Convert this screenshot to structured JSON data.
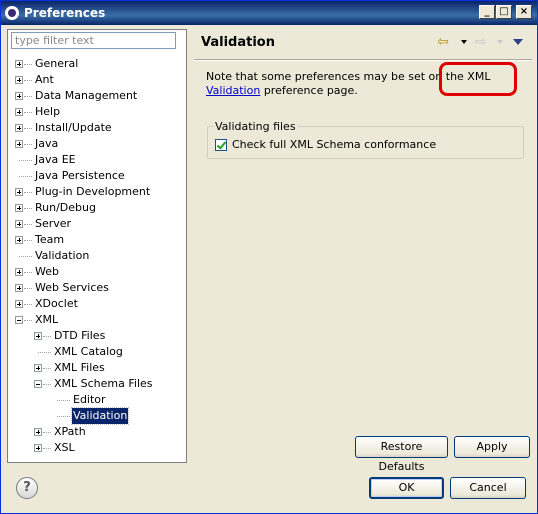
{
  "window": {
    "title": "Preferences",
    "controls": {
      "minimize": "_",
      "maximize": "□",
      "close": "×"
    }
  },
  "filter": {
    "placeholder": "type filter text",
    "value": ""
  },
  "tree": [
    {
      "label": "General",
      "level": 0,
      "expander": "plus"
    },
    {
      "label": "Ant",
      "level": 0,
      "expander": "plus"
    },
    {
      "label": "Data Management",
      "level": 0,
      "expander": "plus"
    },
    {
      "label": "Help",
      "level": 0,
      "expander": "plus"
    },
    {
      "label": "Install/Update",
      "level": 0,
      "expander": "plus"
    },
    {
      "label": "Java",
      "level": 0,
      "expander": "plus"
    },
    {
      "label": "Java EE",
      "level": 0,
      "expander": "none"
    },
    {
      "label": "Java Persistence",
      "level": 0,
      "expander": "none"
    },
    {
      "label": "Plug-in Development",
      "level": 0,
      "expander": "plus"
    },
    {
      "label": "Run/Debug",
      "level": 0,
      "expander": "plus"
    },
    {
      "label": "Server",
      "level": 0,
      "expander": "plus"
    },
    {
      "label": "Team",
      "level": 0,
      "expander": "plus"
    },
    {
      "label": "Validation",
      "level": 0,
      "expander": "none"
    },
    {
      "label": "Web",
      "level": 0,
      "expander": "plus"
    },
    {
      "label": "Web Services",
      "level": 0,
      "expander": "plus"
    },
    {
      "label": "XDoclet",
      "level": 0,
      "expander": "plus"
    },
    {
      "label": "XML",
      "level": 0,
      "expander": "minus"
    },
    {
      "label": "DTD Files",
      "level": 1,
      "expander": "plus"
    },
    {
      "label": "XML Catalog",
      "level": 1,
      "expander": "none"
    },
    {
      "label": "XML Files",
      "level": 1,
      "expander": "plus"
    },
    {
      "label": "XML Schema Files",
      "level": 1,
      "expander": "minus"
    },
    {
      "label": "Editor",
      "level": 2,
      "expander": "none"
    },
    {
      "label": "Validation",
      "level": 2,
      "expander": "none",
      "selected": true
    },
    {
      "label": "XPath",
      "level": 1,
      "expander": "plus"
    },
    {
      "label": "XSL",
      "level": 1,
      "expander": "plus"
    }
  ],
  "page": {
    "title": "Validation",
    "note_prefix": "Note that some preferences may be set on the XML ",
    "note_link": "Validation",
    "note_suffix": " preference page.",
    "group_title": "Validating files",
    "checkbox_label": "Check full XML Schema conformance",
    "checkbox_checked": true
  },
  "buttons": {
    "restore_defaults": "Restore Defaults",
    "apply": "Apply",
    "ok": "OK",
    "cancel": "Cancel",
    "help": "?"
  },
  "icons": {
    "nav_back": "back-arrow-icon",
    "nav_forward": "forward-arrow-icon",
    "view_menu": "view-menu-icon"
  },
  "colors": {
    "highlight": "#e00000",
    "selection": "#0a246a",
    "link": "#0000cc"
  }
}
